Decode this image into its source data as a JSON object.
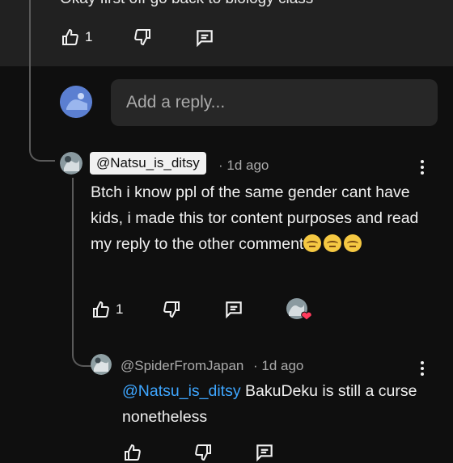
{
  "previous_comment": {
    "cut_text": "Okay first off go back to biology class",
    "like_count": "1"
  },
  "reply_input": {
    "placeholder": "Add a reply..."
  },
  "comment": {
    "author": "@Natsu_is_ditsy",
    "time": "· 1d ago",
    "text": "Btch i know ppl of the same gender cant have kids, i made this tor content purposes and read my reply to the other comment",
    "like_count": "1"
  },
  "reply": {
    "author": "@SpiderFromJapan",
    "time": "· 1d ago",
    "mention": "@Natsu_is_ditsy",
    "text": " BakuDeku is still a curse nonetheless"
  },
  "colors": {
    "background": "#0f0f0f",
    "panel": "#212121",
    "input": "#272727",
    "mention": "#3ea6ff",
    "muted": "#aaaaaa"
  },
  "icons": [
    "thumb-up-icon",
    "thumb-down-icon",
    "reply-comment-icon",
    "kebab-menu-icon",
    "creator-heart-badge"
  ]
}
